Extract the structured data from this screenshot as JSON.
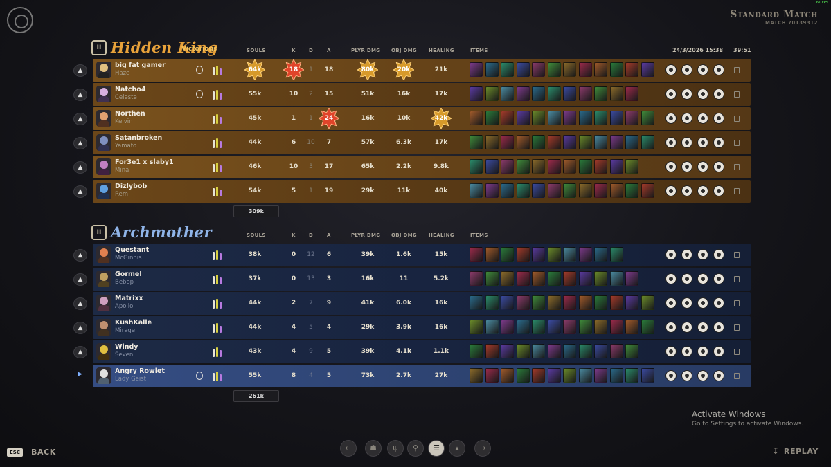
{
  "fps_text": "61 FPS",
  "mode_title": "Standard Match",
  "match_id": "MATCH 70139312",
  "datetime": "24/3/2026 15:38",
  "duration": "39:51",
  "columns": {
    "souls": "SOULS",
    "k": "K",
    "d": "D",
    "a": "A",
    "plyr_dmg": "PLYR DMG",
    "obj_dmg": "OBJ DMG",
    "healing": "HEALING",
    "items": "ITEMS"
  },
  "teams": [
    {
      "name": "Hidden King",
      "badge": "II",
      "result": "Victorious",
      "total_souls": "309k",
      "color": "#e8a23a",
      "players": [
        {
          "name": "big fat gamer",
          "hero": "Haze",
          "souls": "64k",
          "k": "18",
          "d": "1",
          "a": "18",
          "plyr_dmg": "80k",
          "obj_dmg": "20k",
          "healing": "21k"
        },
        {
          "name": "Natcho4",
          "hero": "Celeste",
          "souls": "55k",
          "k": "10",
          "d": "2",
          "a": "15",
          "plyr_dmg": "51k",
          "obj_dmg": "16k",
          "healing": "17k"
        },
        {
          "name": "Northen",
          "hero": "Kelvin",
          "souls": "45k",
          "k": "1",
          "d": "1",
          "a": "24",
          "plyr_dmg": "16k",
          "obj_dmg": "10k",
          "healing": "42k"
        },
        {
          "name": "Satanbroken",
          "hero": "Yamato",
          "souls": "44k",
          "k": "6",
          "d": "10",
          "a": "7",
          "plyr_dmg": "57k",
          "obj_dmg": "6.3k",
          "healing": "17k"
        },
        {
          "name": "For3e1 x slaby1",
          "hero": "Mina",
          "souls": "46k",
          "k": "10",
          "d": "3",
          "a": "17",
          "plyr_dmg": "65k",
          "obj_dmg": "2.2k",
          "healing": "9.8k"
        },
        {
          "name": "Dizlybob",
          "hero": "Rem",
          "souls": "54k",
          "k": "5",
          "d": "1",
          "a": "19",
          "plyr_dmg": "29k",
          "obj_dmg": "11k",
          "healing": "40k"
        }
      ]
    },
    {
      "name": "Archmother",
      "badge": "II",
      "result": "",
      "total_souls": "261k",
      "color": "#8fb4e8",
      "players": [
        {
          "name": "Questant",
          "hero": "McGinnis",
          "souls": "38k",
          "k": "0",
          "d": "12",
          "a": "6",
          "plyr_dmg": "39k",
          "obj_dmg": "1.6k",
          "healing": "15k"
        },
        {
          "name": "Gormel",
          "hero": "Bebop",
          "souls": "37k",
          "k": "0",
          "d": "13",
          "a": "3",
          "plyr_dmg": "16k",
          "obj_dmg": "11",
          "healing": "5.2k"
        },
        {
          "name": "Matrixx",
          "hero": "Apollo",
          "souls": "44k",
          "k": "2",
          "d": "7",
          "a": "9",
          "plyr_dmg": "41k",
          "obj_dmg": "6.0k",
          "healing": "16k"
        },
        {
          "name": "KushKalle",
          "hero": "Mirage",
          "souls": "44k",
          "k": "4",
          "d": "5",
          "a": "4",
          "plyr_dmg": "29k",
          "obj_dmg": "3.9k",
          "healing": "16k"
        },
        {
          "name": "Windy",
          "hero": "Seven",
          "souls": "43k",
          "k": "4",
          "d": "9",
          "a": "5",
          "plyr_dmg": "39k",
          "obj_dmg": "4.1k",
          "healing": "1.1k"
        },
        {
          "name": "Angry Rowlet",
          "hero": "Lady Geist",
          "souls": "55k",
          "k": "8",
          "d": "4",
          "a": "5",
          "plyr_dmg": "73k",
          "obj_dmg": "2.7k",
          "healing": "27k"
        }
      ]
    }
  ],
  "bottom": {
    "esc": "ESC",
    "back": "BACK",
    "replay": "REPLAY"
  },
  "watermark": {
    "line1": "Activate Windows",
    "line2": "Go to Settings to activate Windows."
  },
  "icons": [
    "back-arrow-icon",
    "trophy-icon",
    "cactus-icon",
    "tree-icon",
    "list-icon",
    "chart-icon",
    "forward-arrow-icon"
  ]
}
